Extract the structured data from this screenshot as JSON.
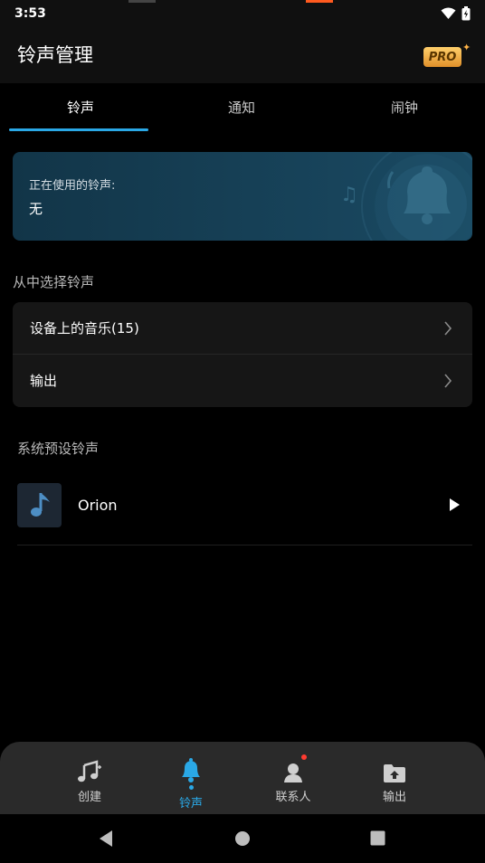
{
  "status_bar": {
    "time": "3:53",
    "icons": [
      "wifi-icon",
      "battery-charging-icon"
    ]
  },
  "header": {
    "title": "铃声管理",
    "pro_badge": "PRO"
  },
  "tabs": [
    {
      "label": "铃声",
      "active": true
    },
    {
      "label": "通知",
      "active": false
    },
    {
      "label": "闹钟",
      "active": false
    }
  ],
  "current": {
    "label": "正在使用的铃声:",
    "value": "无"
  },
  "choose_section": {
    "title": "从中选择铃声",
    "items": [
      {
        "label": "设备上的音乐(15)"
      },
      {
        "label": "输出"
      }
    ]
  },
  "preset_section": {
    "title": "系统预设铃声",
    "items": [
      {
        "name": "Orion"
      }
    ]
  },
  "bottom_nav": [
    {
      "label": "创建",
      "icon": "music-create-icon",
      "active": false
    },
    {
      "label": "铃声",
      "icon": "bell-icon",
      "active": true
    },
    {
      "label": "联系人",
      "icon": "contact-icon",
      "active": false,
      "notification": true
    },
    {
      "label": "输出",
      "icon": "folder-upload-icon",
      "active": false
    }
  ],
  "colors": {
    "accent": "#2aa8e6",
    "card": "#1a4a63",
    "pro": "#f0a83a"
  }
}
